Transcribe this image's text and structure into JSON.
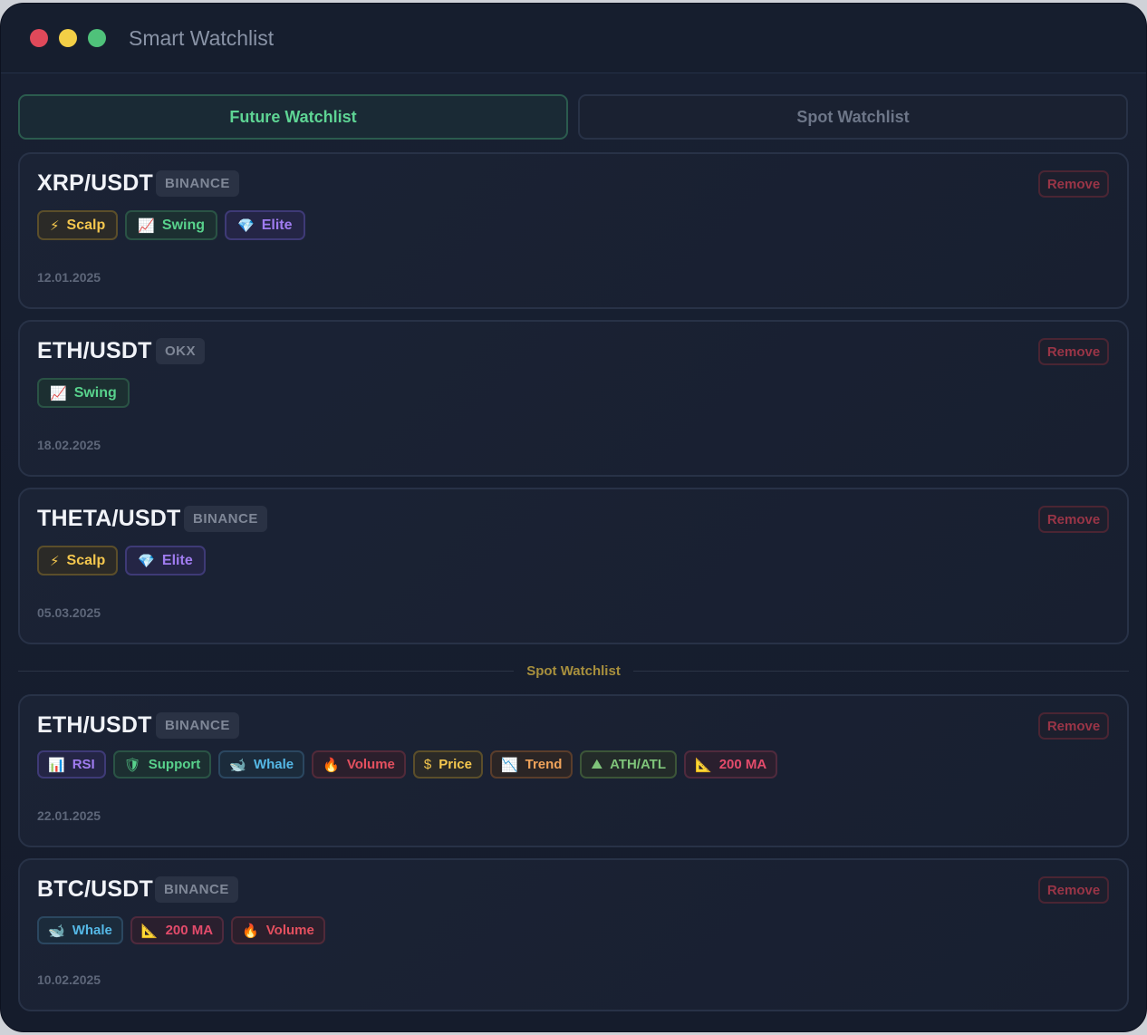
{
  "window": {
    "title": "Smart Watchlist"
  },
  "tabs": [
    {
      "label": "Future Watchlist",
      "active": true
    },
    {
      "label": "Spot Watchlist",
      "active": false
    }
  ],
  "future": [
    {
      "symbol": "XRP/USDT",
      "exchange": "BINANCE",
      "date": "12.01.2025",
      "remove": "Remove",
      "tags": [
        {
          "icon": "⚡",
          "icon_name": "lightning-icon",
          "label": "Scalp",
          "color": "yellow"
        },
        {
          "icon": "📈",
          "icon_name": "chart-up-icon",
          "label": "Swing",
          "color": "green"
        },
        {
          "icon": "💎",
          "icon_name": "gem-icon",
          "label": "Elite",
          "color": "purple"
        }
      ]
    },
    {
      "symbol": "ETH/USDT",
      "exchange": "OKX",
      "date": "18.02.2025",
      "remove": "Remove",
      "tags": [
        {
          "icon": "📈",
          "icon_name": "chart-up-icon",
          "label": "Swing",
          "color": "green"
        }
      ]
    },
    {
      "symbol": "THETA/USDT",
      "exchange": "BINANCE",
      "date": "05.03.2025",
      "remove": "Remove",
      "tags": [
        {
          "icon": "⚡",
          "icon_name": "lightning-icon",
          "label": "Scalp",
          "color": "yellow"
        },
        {
          "icon": "💎",
          "icon_name": "gem-icon",
          "label": "Elite",
          "color": "purple"
        }
      ]
    }
  ],
  "divider_label": "Spot Watchlist",
  "spot": [
    {
      "symbol": "ETH/USDT",
      "exchange": "BINANCE",
      "date": "22.01.2025",
      "remove": "Remove",
      "tags": [
        {
          "icon": "📊",
          "icon_name": "bar-chart-icon",
          "label": "RSI",
          "color": "purple"
        },
        {
          "icon": "🛡",
          "icon_name": "shield-icon",
          "label": "Support",
          "color": "green"
        },
        {
          "icon": "🐋",
          "icon_name": "whale-icon",
          "label": "Whale",
          "color": "blue"
        },
        {
          "icon": "🔥",
          "icon_name": "fire-icon",
          "label": "Volume",
          "color": "red"
        },
        {
          "icon": "$",
          "icon_name": "dollar-icon",
          "label": "Price",
          "color": "yellow"
        },
        {
          "icon": "📉",
          "icon_name": "chart-down-icon",
          "label": "Trend",
          "color": "orange"
        },
        {
          "icon": "⛰",
          "icon_name": "mountain-icon",
          "label": "ATH/ATL",
          "color": "olive"
        },
        {
          "icon": "📐",
          "icon_name": "ruler-triangle-icon",
          "label": "200 MA",
          "color": "rose"
        }
      ]
    },
    {
      "symbol": "BTC/USDT",
      "exchange": "BINANCE",
      "date": "10.02.2025",
      "remove": "Remove",
      "tags": [
        {
          "icon": "🐋",
          "icon_name": "whale-icon",
          "label": "Whale",
          "color": "blue"
        },
        {
          "icon": "📐",
          "icon_name": "ruler-triangle-icon",
          "label": "200 MA",
          "color": "rose"
        },
        {
          "icon": "🔥",
          "icon_name": "fire-icon",
          "label": "Volume",
          "color": "red"
        }
      ]
    }
  ]
}
